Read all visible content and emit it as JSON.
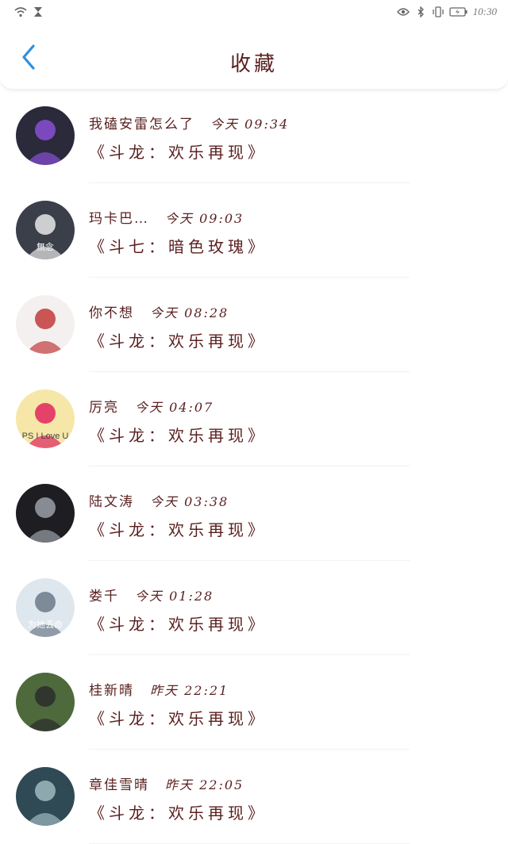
{
  "status": {
    "time": "10:30"
  },
  "header": {
    "title": "收藏"
  },
  "items": [
    {
      "name": "我磕安雷怎么了",
      "time": "今天 09:34",
      "book": "《斗龙：欢乐再现》",
      "avatar_bg": "#2a2a3a",
      "avatar_fg": "#8a4fd6",
      "avatar_text": ""
    },
    {
      "name": "玛卡巴…",
      "time": "今天 09:03",
      "book": "《斗七：暗色玫瑰》",
      "avatar_bg": "#3a3f4a",
      "avatar_fg": "#e8e8e8",
      "avatar_text": "無念"
    },
    {
      "name": "你不想",
      "time": "今天 08:28",
      "book": "《斗龙：欢乐再现》",
      "avatar_bg": "#f4f0f0",
      "avatar_fg": "#c23a3a",
      "avatar_text": ""
    },
    {
      "name": "厉亮",
      "time": "今天 04:07",
      "book": "《斗龙：欢乐再现》",
      "avatar_bg": "#f6e7a8",
      "avatar_fg": "#e0245e",
      "avatar_text": "PS I Love U"
    },
    {
      "name": "陆文涛",
      "time": "今天 03:38",
      "book": "《斗龙：欢乐再现》",
      "avatar_bg": "#1e1e22",
      "avatar_fg": "#9aa0a8",
      "avatar_text": ""
    },
    {
      "name": "娄千",
      "time": "今天 01:28",
      "book": "《斗龙：欢乐再现》",
      "avatar_bg": "#dfe7ee",
      "avatar_fg": "#6c7a88",
      "avatar_text": "为她丢命"
    },
    {
      "name": "桂新晴",
      "time": "昨天 22:21",
      "book": "《斗龙：欢乐再现》",
      "avatar_bg": "#4e6a3c",
      "avatar_fg": "#2b2b2b",
      "avatar_text": ""
    },
    {
      "name": "章佳雪晴",
      "time": "昨天 22:05",
      "book": "《斗龙：欢乐再现》",
      "avatar_bg": "#2f4a55",
      "avatar_fg": "#9fb8c0",
      "avatar_text": ""
    }
  ],
  "colors": {
    "accent": "#2f8fdc",
    "text": "#5a1f1f"
  }
}
